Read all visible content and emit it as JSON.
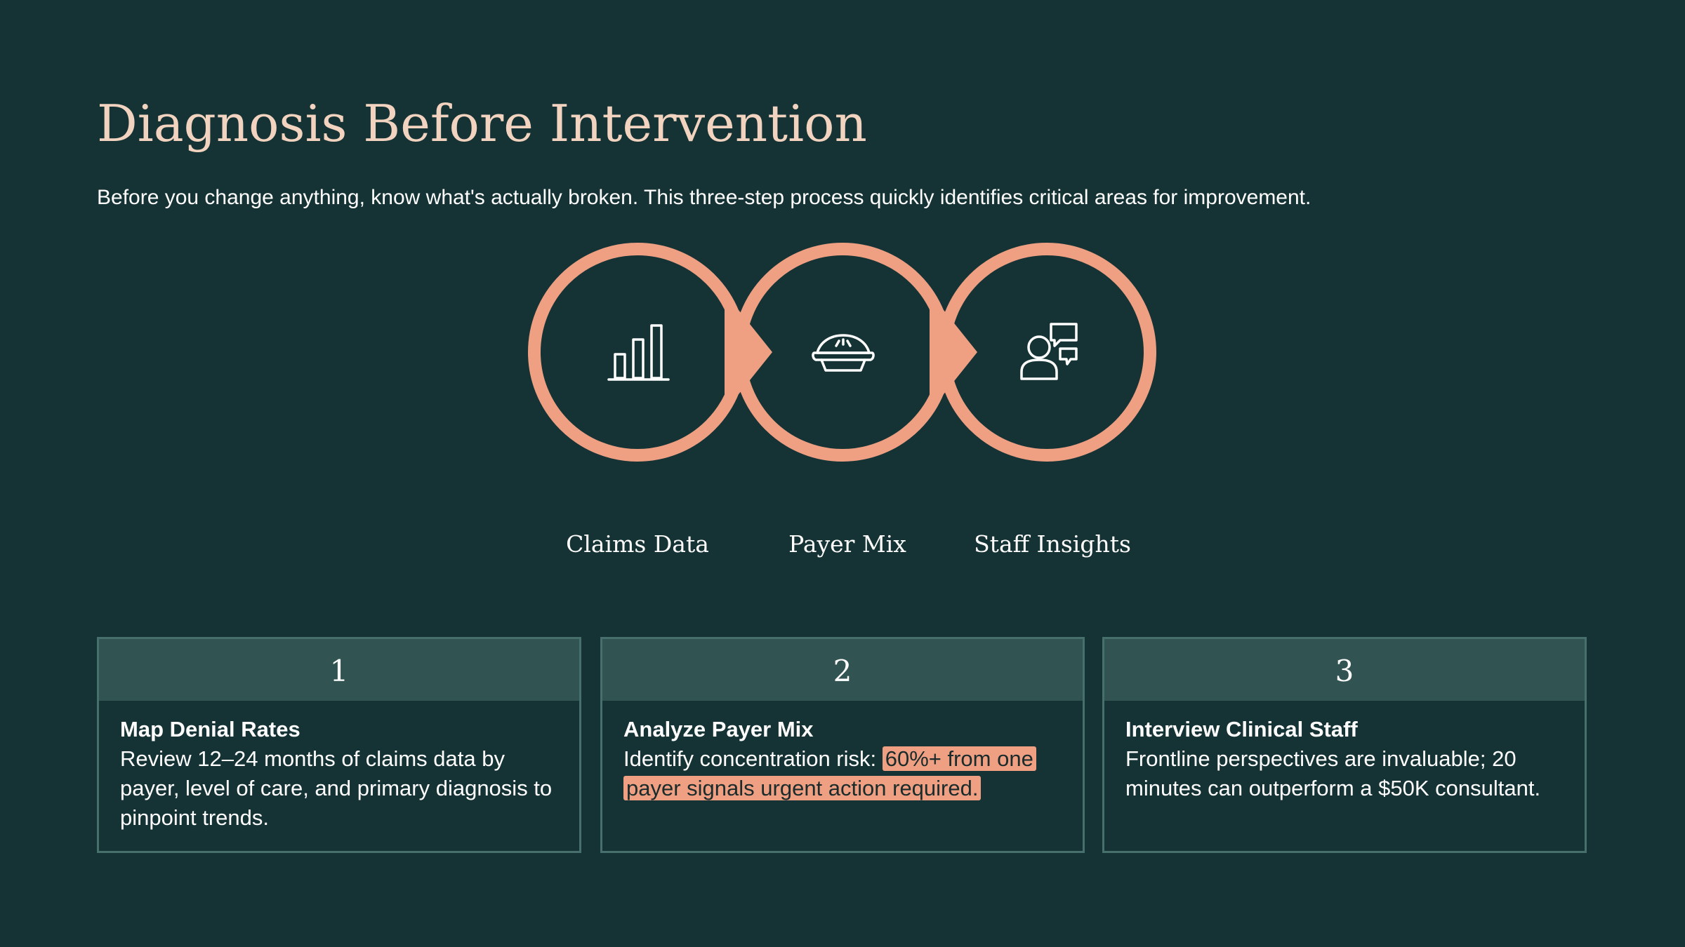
{
  "title": "Diagnosis Before Intervention",
  "subtitle": "Before you change anything, know what's actually broken. This three-step process quickly identifies critical areas for improvement.",
  "colors": {
    "background": "#153335",
    "accent": "#ef9f82",
    "title": "#f2d3bf",
    "card_header": "#315453",
    "card_border": "#47706d"
  },
  "steps": [
    {
      "label": "Claims Data",
      "icon": "bar-chart-icon"
    },
    {
      "label": "Payer Mix",
      "icon": "pie-icon"
    },
    {
      "label": "Staff Insights",
      "icon": "person-chat-icon"
    }
  ],
  "cards": [
    {
      "number": "1",
      "title": "Map Denial Rates",
      "text": "Review 12–24 months of claims data by payer, level of care, and primary diagnosis to pinpoint trends.",
      "highlight": ""
    },
    {
      "number": "2",
      "title": "Analyze Payer Mix",
      "text": "Identify concentration risk: ",
      "highlight": "60%+ from one payer signals urgent action required."
    },
    {
      "number": "3",
      "title": "Interview Clinical Staff",
      "text": "Frontline perspectives are invaluable; 20 minutes can outperform a $50K consultant.",
      "highlight": ""
    }
  ]
}
